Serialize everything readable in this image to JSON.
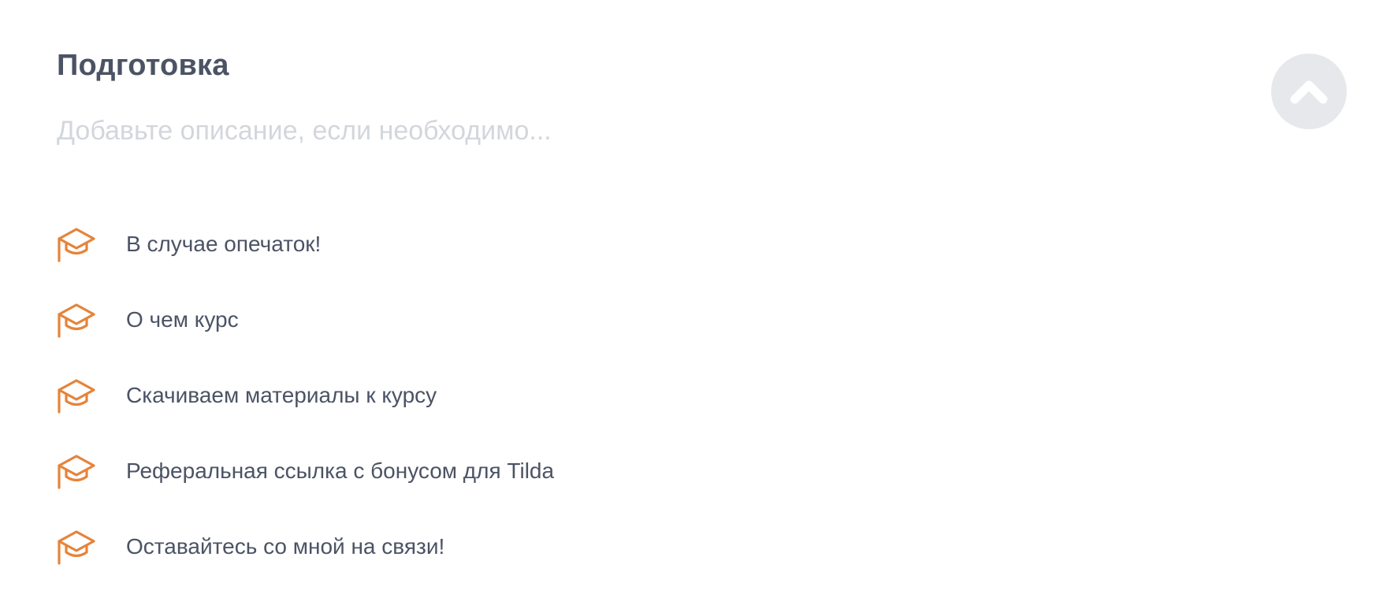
{
  "section": {
    "title": "Подготовка",
    "description_placeholder": "Добавьте описание, если необходимо...",
    "description_value": ""
  },
  "icons": {
    "lesson_icon": "graduation-cap-icon",
    "collapse_icon": "chevron-up-icon"
  },
  "colors": {
    "accent": "#e5843a",
    "text": "#4b5364",
    "placeholder": "#d3d6dc",
    "collapse_button_bg": "#e7e8eb"
  },
  "lessons": [
    {
      "label": "В случае опечаток!"
    },
    {
      "label": "О чем курс"
    },
    {
      "label": "Скачиваем материалы к курсу"
    },
    {
      "label": "Реферальная ссылка с бонусом для Tilda"
    },
    {
      "label": "Оставайтесь со мной на связи!"
    }
  ]
}
